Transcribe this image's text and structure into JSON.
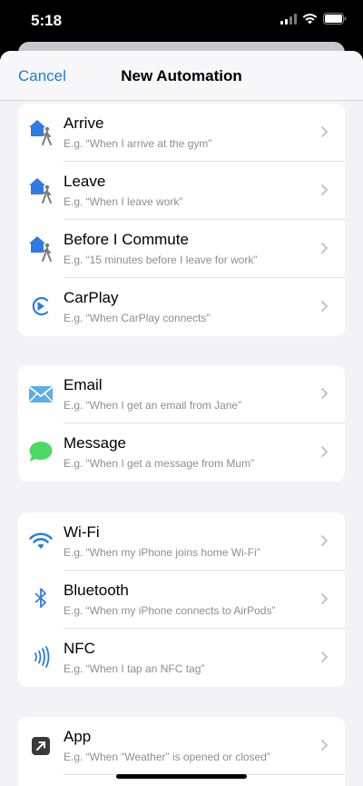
{
  "status": {
    "time": "5:18"
  },
  "nav": {
    "cancel": "Cancel",
    "title": "New Automation"
  },
  "groups": [
    {
      "items": [
        {
          "title": "Arrive",
          "subtitle": "E.g. “When I arrive at the gym”",
          "icon": "arrive-icon"
        },
        {
          "title": "Leave",
          "subtitle": "E.g. “When I leave work”",
          "icon": "leave-icon"
        },
        {
          "title": "Before I Commute",
          "subtitle": "E.g. “15 minutes before I leave for work”",
          "icon": "commute-icon"
        },
        {
          "title": "CarPlay",
          "subtitle": "E.g. “When CarPlay connects”",
          "icon": "carplay-icon"
        }
      ]
    },
    {
      "items": [
        {
          "title": "Email",
          "subtitle": "E.g. “When I get an email from Jane”",
          "icon": "email-icon"
        },
        {
          "title": "Message",
          "subtitle": "E.g. “When I get a message from Mum”",
          "icon": "message-icon"
        }
      ]
    },
    {
      "items": [
        {
          "title": "Wi-Fi",
          "subtitle": "E.g. “When my iPhone joins home Wi-Fi”",
          "icon": "wifi-icon"
        },
        {
          "title": "Bluetooth",
          "subtitle": "E.g. “When my iPhone connects to AirPods”",
          "icon": "bluetooth-icon"
        },
        {
          "title": "NFC",
          "subtitle": "E.g. “When I tap an NFC tag”",
          "icon": "nfc-icon"
        }
      ]
    },
    {
      "items": [
        {
          "title": "App",
          "subtitle": "E.g. “When “Weather” is opened or closed”",
          "icon": "app-icon"
        }
      ]
    }
  ],
  "colors": {
    "accent": "#1c7bd9",
    "home": "#2f7ae5",
    "message": "#4cd964",
    "email": "#5aaee6"
  }
}
